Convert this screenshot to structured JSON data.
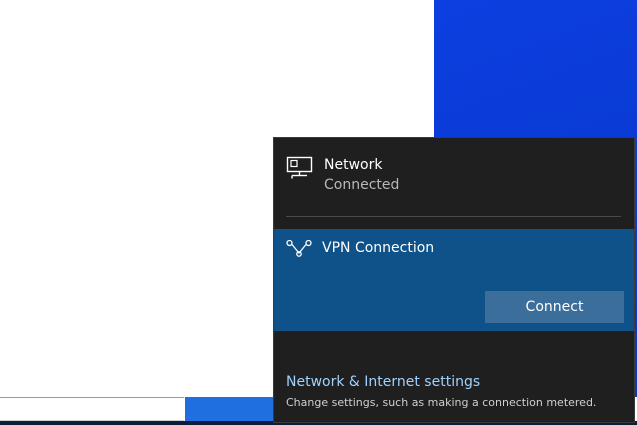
{
  "network": {
    "title": "Network",
    "status": "Connected",
    "icon": "wired-network-icon"
  },
  "vpn": {
    "label": "VPN Connection",
    "icon": "vpn-icon",
    "connect_label": "Connect"
  },
  "settings": {
    "link_label": "Network & Internet settings",
    "description": "Change settings, such as making a connection metered."
  },
  "colors": {
    "flyout_bg": "#1f1f1f",
    "vpn_selected_bg": "#0f5189",
    "connect_button_bg": "#3b6e9a",
    "link_color": "#9fd2ff",
    "desktop_blue": "#0a3bd6"
  }
}
